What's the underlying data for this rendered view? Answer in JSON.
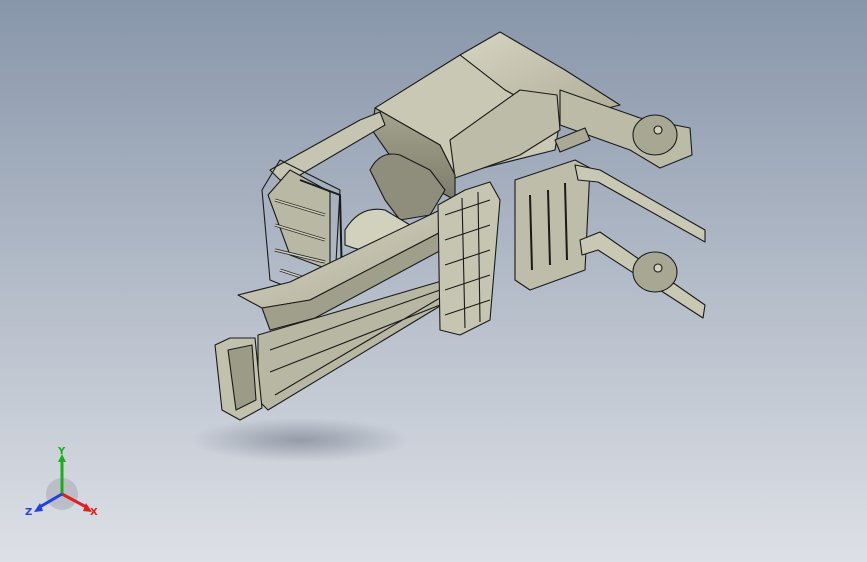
{
  "viewport": {
    "background_top": "#8896aa",
    "background_bottom": "#dde0e6",
    "model_color": "#c4c3b0",
    "model_shade": "#8f8e7c",
    "edge_color": "#1a1a1a"
  },
  "triad": {
    "x_label": "X",
    "y_label": "Y",
    "z_label": "Z",
    "x_color": "#e02020",
    "y_color": "#18b018",
    "z_color": "#2040e0"
  }
}
